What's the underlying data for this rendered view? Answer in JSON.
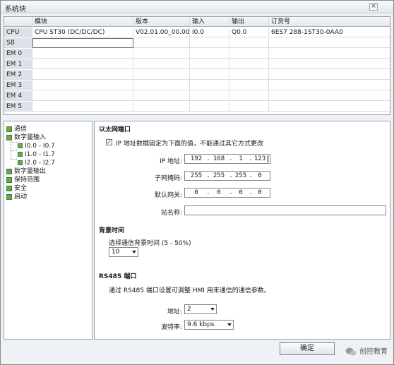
{
  "window": {
    "title": "系统块",
    "close_label": "×"
  },
  "table": {
    "headers": [
      "",
      "模块",
      "版本",
      "输入",
      "输出",
      "订货号"
    ],
    "rows": [
      [
        "CPU",
        "CPU ST30 (DC/DC/DC)",
        "V02.01.00_00.00...",
        "I0.0",
        "Q0.0",
        "6ES7 288-1ST30-0AA0"
      ],
      [
        "SB",
        "",
        "",
        "",
        "",
        ""
      ],
      [
        "EM 0",
        "",
        "",
        "",
        "",
        ""
      ],
      [
        "EM 1",
        "",
        "",
        "",
        "",
        ""
      ],
      [
        "EM 2",
        "",
        "",
        "",
        "",
        ""
      ],
      [
        "EM 3",
        "",
        "",
        "",
        "",
        ""
      ],
      [
        "EM 4",
        "",
        "",
        "",
        "",
        ""
      ],
      [
        "EM 5",
        "",
        "",
        "",
        "",
        ""
      ]
    ]
  },
  "tree": {
    "items": [
      {
        "label": "通信",
        "level": 0
      },
      {
        "label": "数字量输入",
        "level": 0
      },
      {
        "label": "I0.0 - I0.7",
        "level": 1
      },
      {
        "label": "I1.0 - I1.7",
        "level": 1
      },
      {
        "label": "I2.0 - I2.7",
        "level": 1
      },
      {
        "label": "数字量输出",
        "level": 0
      },
      {
        "label": "保持范围",
        "level": 0
      },
      {
        "label": "安全",
        "level": 0
      },
      {
        "label": "启动",
        "level": 0
      }
    ]
  },
  "ethernet": {
    "title": "以太网端口",
    "fixed_ip_checked": true,
    "fixed_ip_label": "IP 地址数据固定为下面的值，不能通过其它方式更改",
    "ip_label": "IP 地址:",
    "ip": [
      "192",
      "168",
      "1",
      "123"
    ],
    "subnet_label": "子网掩码:",
    "subnet": [
      "255",
      "255",
      "255",
      "0"
    ],
    "gateway_label": "默认网关:",
    "gateway": [
      "0",
      "0",
      "0",
      "0"
    ],
    "station_label": "站名称:",
    "station_value": ""
  },
  "background": {
    "title": "背景时间",
    "select_label": "选择通信背景时间 (5 - 50%)",
    "value": "10"
  },
  "rs485": {
    "title": "RS485 端口",
    "description": "通过 RS485 端口设置可调整 HMI 用来通信的通信参数。",
    "address_label": "地址:",
    "address_value": "2",
    "baud_label": "波特率:",
    "baud_value": "9.6 kbps"
  },
  "footer": {
    "ok_label": "确定",
    "watermark": "创控教育"
  }
}
